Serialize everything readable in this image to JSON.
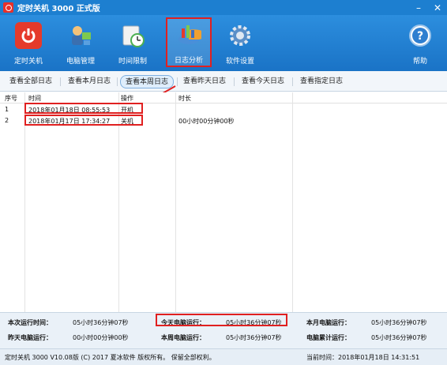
{
  "window": {
    "title": "定时关机 3000 正式版"
  },
  "toolbar": {
    "items": [
      {
        "label": "定时关机",
        "icon": "power-icon"
      },
      {
        "label": "电脑管理",
        "icon": "computer-manage-icon"
      },
      {
        "label": "时间限制",
        "icon": "clock-icon"
      },
      {
        "label": "日志分析",
        "icon": "chart-icon"
      },
      {
        "label": "软件设置",
        "icon": "gear-icon"
      },
      {
        "label": "帮助",
        "icon": "help-icon"
      }
    ]
  },
  "tabs": [
    {
      "label": "查看全部日志"
    },
    {
      "label": "查看本月日志"
    },
    {
      "label": "查看本周日志"
    },
    {
      "label": "查看昨天日志"
    },
    {
      "label": "查看今天日志"
    },
    {
      "label": "查看指定日志"
    }
  ],
  "table": {
    "headers": [
      "序号",
      "时间",
      "操作",
      "时长"
    ],
    "rows": [
      {
        "no": "1",
        "time": "2018年01月18日 08:55:53",
        "action": "开机",
        "duration": ""
      },
      {
        "no": "2",
        "time": "2018年01月17日 17:34:27",
        "action": "关机",
        "duration": "00小时00分钟00秒"
      }
    ]
  },
  "stats": {
    "this_run_label": "本次运行时间：",
    "this_run_value": "05小时36分钟07秒",
    "today_label": "今天电脑运行：",
    "today_value": "05小时36分钟07秒",
    "month_label": "本月电脑运行：",
    "month_value": "05小时36分钟07秒",
    "yesterday_label": "昨天电脑运行：",
    "yesterday_value": "00小时00分钟00秒",
    "week_label": "本周电脑运行：",
    "week_value": "05小时36分钟07秒",
    "total_label": "电脑累计运行：",
    "total_value": "05小时36分钟07秒"
  },
  "status": {
    "copyright": "定时关机 3000 V10.08版 (C) 2017  夏冰软件 版权所有。 保留全部权利。",
    "current_time": "当前时间：2018年01月18日 14:31:51"
  },
  "colors": {
    "accent": "#1d7fd0",
    "highlight": "#e02020"
  }
}
